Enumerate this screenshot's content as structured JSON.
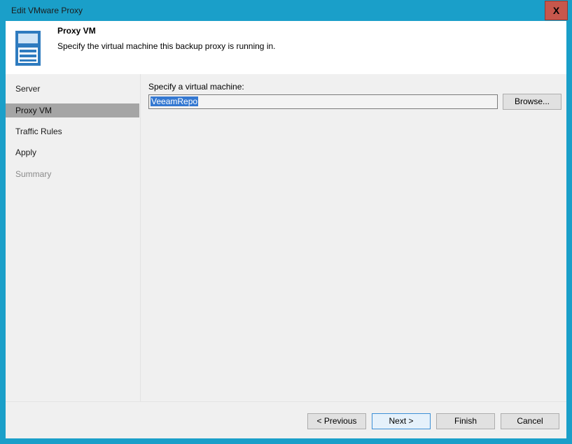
{
  "window": {
    "title": "Edit VMware Proxy",
    "close_label": "X"
  },
  "header": {
    "icon": "server-icon",
    "title": "Proxy VM",
    "subtitle": "Specify the virtual machine this backup proxy is running in."
  },
  "nav": {
    "items": [
      {
        "label": "Server",
        "state": "normal"
      },
      {
        "label": "Proxy VM",
        "state": "selected"
      },
      {
        "label": "Traffic Rules",
        "state": "normal"
      },
      {
        "label": "Apply",
        "state": "normal"
      },
      {
        "label": "Summary",
        "state": "disabled"
      }
    ]
  },
  "content": {
    "vm_label": "Specify a virtual machine:",
    "vm_value": "VeeamRepo",
    "browse_label": "Browse..."
  },
  "footer": {
    "previous_label": "< Previous",
    "next_label": "Next >",
    "finish_label": "Finish",
    "cancel_label": "Cancel"
  },
  "colors": {
    "title_bar": "#1a9fc9",
    "close_button": "#c7574c",
    "nav_selected": "#a5a5a5",
    "text_selection": "#3478d1"
  }
}
